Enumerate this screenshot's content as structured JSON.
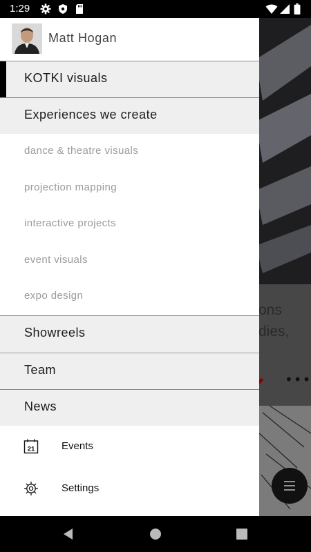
{
  "status_bar": {
    "time": "1:29",
    "icons": [
      "gear-icon",
      "shield-icon",
      "sd-card-icon",
      "wifi-icon",
      "signal-icon",
      "battery-icon"
    ]
  },
  "background": {
    "card_text_line1": "ons",
    "card_text_line2": "dies,",
    "more_label": "•••"
  },
  "drawer": {
    "profile_name": "Matt Hogan",
    "sections": [
      {
        "label": "KOTKI visuals",
        "active": true
      },
      {
        "label": "Experiences we create",
        "active": false
      }
    ],
    "sub_items": [
      {
        "label": "dance & theatre visuals"
      },
      {
        "label": "projection mapping"
      },
      {
        "label": "interactive projects"
      },
      {
        "label": "event visuals"
      },
      {
        "label": "expo design"
      }
    ],
    "more_sections": [
      {
        "label": "Showreels"
      },
      {
        "label": "Team"
      },
      {
        "label": "News"
      }
    ],
    "menu_items": [
      {
        "label": "Events",
        "icon": "calendar-icon",
        "icon_text": "21"
      },
      {
        "label": "Settings",
        "icon": "gear-icon"
      }
    ]
  },
  "nav_bar": {
    "buttons": [
      "back-icon",
      "home-icon",
      "recents-icon"
    ]
  },
  "colors": {
    "drawer_bg": "#ffffff",
    "section_bg": "#efefef",
    "sub_item_text": "#9a9a9a",
    "accent_bar": "#000000"
  }
}
